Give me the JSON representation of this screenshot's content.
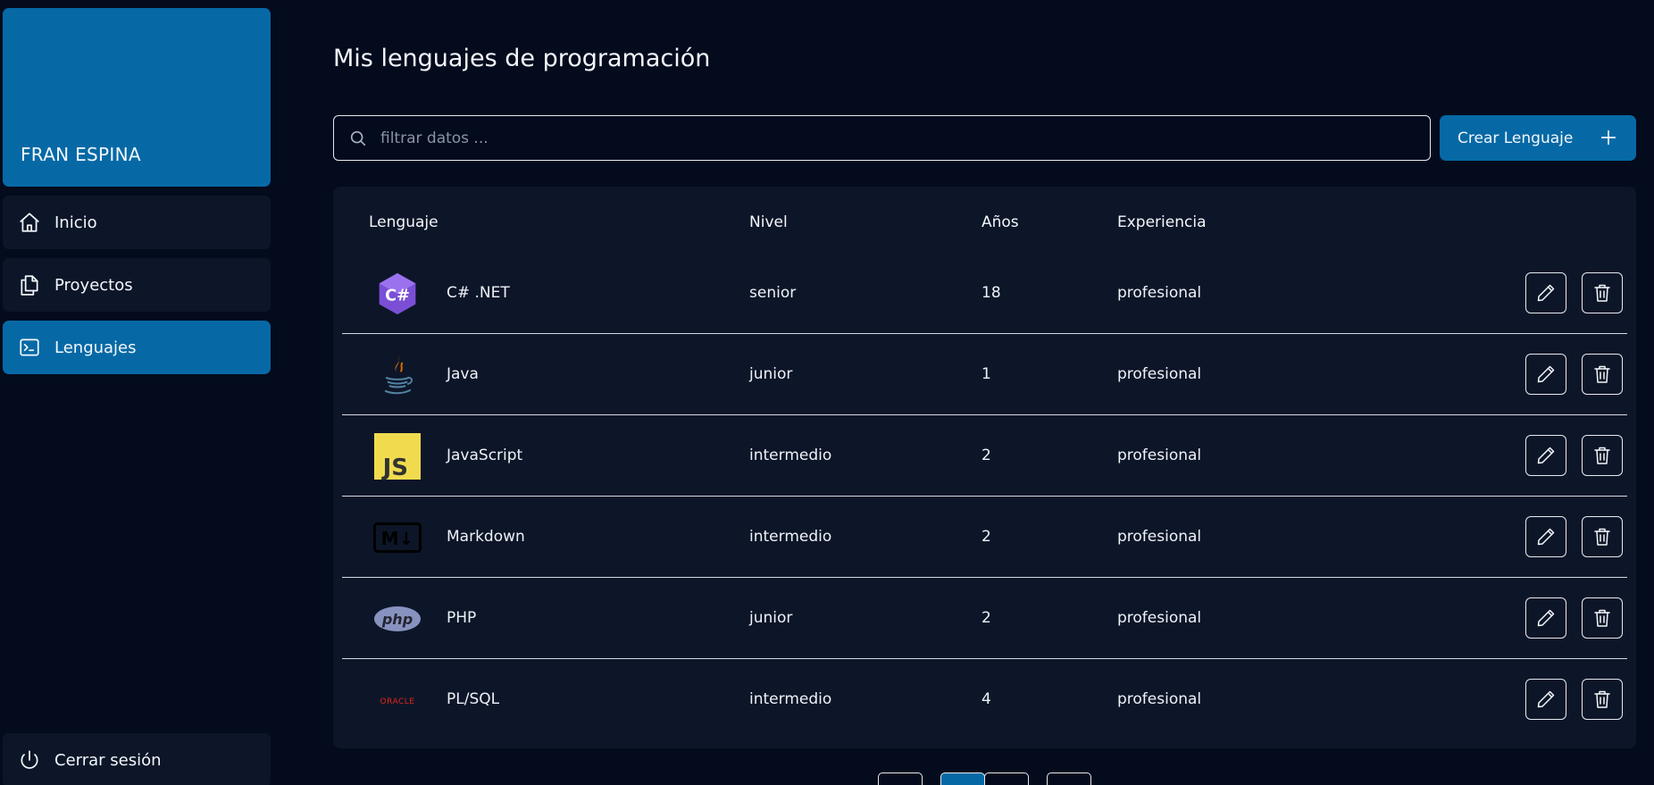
{
  "sidebar": {
    "profile_name": "FRAN ESPINA",
    "items": [
      {
        "label": "Inicio",
        "icon": "home-icon",
        "active": false
      },
      {
        "label": "Proyectos",
        "icon": "documents-icon",
        "active": false
      },
      {
        "label": "Lenguajes",
        "icon": "terminal-icon",
        "active": true
      }
    ],
    "logout_label": "Cerrar sesión"
  },
  "main": {
    "title": "Mis lenguajes de programación",
    "search_placeholder": "filtrar datos ...",
    "create_button_label": "Crear Lenguaje",
    "table": {
      "headers": [
        "Lenguaje",
        "Nivel",
        "Años",
        "Experiencia"
      ],
      "rows": [
        {
          "name": "C# .NET",
          "level": "senior",
          "years": "18",
          "experience": "profesional",
          "logo": "csharp-logo"
        },
        {
          "name": "Java",
          "level": "junior",
          "years": "1",
          "experience": "profesional",
          "logo": "java-logo"
        },
        {
          "name": "JavaScript",
          "level": "intermedio",
          "years": "2",
          "experience": "profesional",
          "logo": "javascript-logo"
        },
        {
          "name": "Markdown",
          "level": "intermedio",
          "years": "2",
          "experience": "profesional",
          "logo": "markdown-logo"
        },
        {
          "name": "PHP",
          "level": "junior",
          "years": "2",
          "experience": "profesional",
          "logo": "php-logo"
        },
        {
          "name": "PL/SQL",
          "level": "intermedio",
          "years": "4",
          "experience": "profesional",
          "logo": "oracle-logo"
        }
      ]
    }
  },
  "logos": {
    "csharp_text": "C#",
    "js_text": "JS",
    "markdown_text": "M↓",
    "php_text": "php",
    "oracle_text": "ORACLE"
  },
  "colors": {
    "background": "#030b1d",
    "panel": "#0d1628",
    "accent": "#0669a6"
  }
}
